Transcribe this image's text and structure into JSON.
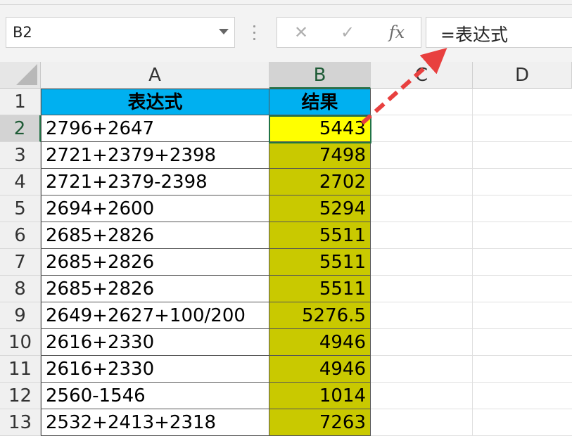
{
  "name_box": {
    "value": "B2"
  },
  "formula_bar": {
    "cancel_glyph": "✕",
    "enter_glyph": "✓",
    "fx_label": "fx",
    "formula": "=表达式"
  },
  "columns": [
    "A",
    "B",
    "C",
    "D"
  ],
  "header_row": {
    "row": "1",
    "a": "表达式",
    "b": "结果"
  },
  "rows": [
    {
      "row": "2",
      "a": "2796+2647",
      "b": "5443"
    },
    {
      "row": "3",
      "a": "2721+2379+2398",
      "b": "7498"
    },
    {
      "row": "4",
      "a": "2721+2379-2398",
      "b": "2702"
    },
    {
      "row": "5",
      "a": "2694+2600",
      "b": "5294"
    },
    {
      "row": "6",
      "a": "2685+2826",
      "b": "5511"
    },
    {
      "row": "7",
      "a": "2685+2826",
      "b": "5511"
    },
    {
      "row": "8",
      "a": "2685+2826",
      "b": "5511"
    },
    {
      "row": "9",
      "a": "2649+2627+100/200",
      "b": "5276.5"
    },
    {
      "row": "10",
      "a": "2616+2330",
      "b": "4946"
    },
    {
      "row": "11",
      "a": "2616+2330",
      "b": "4946"
    },
    {
      "row": "12",
      "a": "2560-1546",
      "b": "1014"
    },
    {
      "row": "13",
      "a": "2532+2413+2318",
      "b": "7263"
    }
  ],
  "colors": {
    "header_fill": "#00b0f0",
    "active_cell_fill": "#ffff00",
    "result_fill": "#c9c900",
    "arrow": "#e8403f"
  }
}
